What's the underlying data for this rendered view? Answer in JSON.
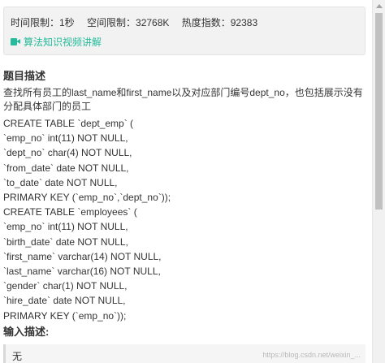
{
  "info": {
    "time_limit": "时间限制：1秒",
    "space_limit": "空间限制：32768K",
    "heat_index": "热度指数：92383",
    "video_link": "算法知识视频讲解"
  },
  "description": {
    "title": "题目描述",
    "text": "查找所有员工的last_name和first_name以及对应部门编号dept_no，也包括展示没有分配具体部门的员工",
    "code_lines": [
      "CREATE TABLE `dept_emp` (",
      "`emp_no` int(11) NOT NULL,",
      "`dept_no` char(4) NOT NULL,",
      "`from_date` date NOT NULL,",
      "`to_date` date NOT NULL,",
      "PRIMARY KEY (`emp_no`,`dept_no`));",
      "CREATE TABLE `employees` (",
      "`emp_no` int(11) NOT NULL,",
      "`birth_date` date NOT NULL,",
      "`first_name` varchar(14) NOT NULL,",
      "`last_name` varchar(16) NOT NULL,",
      "`gender` char(1) NOT NULL,",
      "`hire_date` date NOT NULL,",
      "PRIMARY KEY (`emp_no`));"
    ]
  },
  "input": {
    "title": "输入描述:",
    "value": "无",
    "watermark": "https://blog.csdn.net/weixin_..."
  },
  "icons": {
    "video": "video-camera-icon"
  },
  "colors": {
    "accent": "#25bb9b",
    "panel_bg": "#f2f2f2"
  }
}
